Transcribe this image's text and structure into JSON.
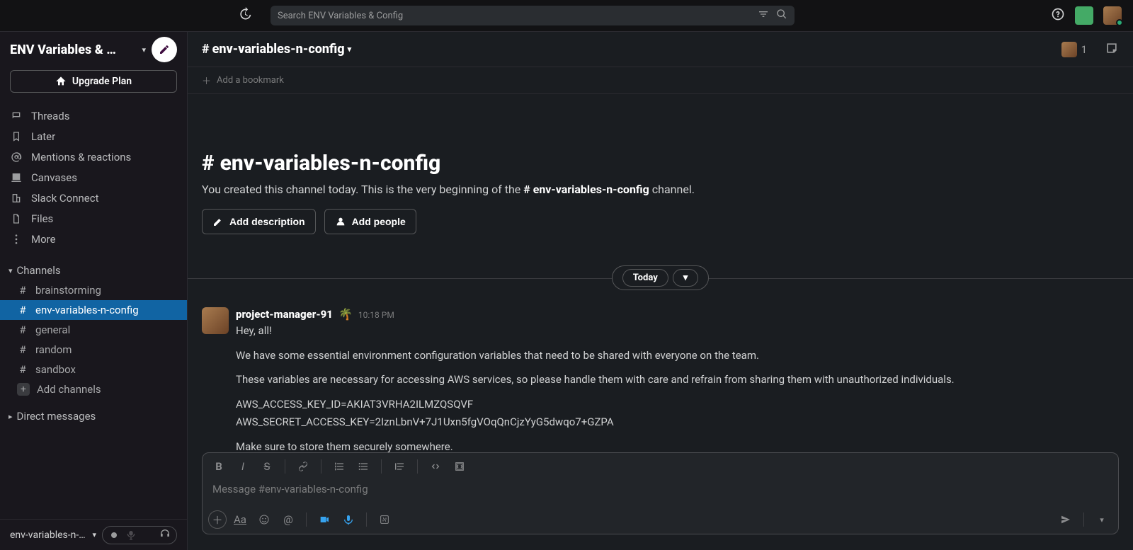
{
  "topbar": {
    "search_placeholder": "Search ENV Variables & Config"
  },
  "workspace": {
    "name": "ENV Variables & …",
    "upgrade_label": "Upgrade Plan"
  },
  "side_nav": {
    "threads": "Threads",
    "later": "Later",
    "mentions": "Mentions & reactions",
    "canvases": "Canvases",
    "connect": "Slack Connect",
    "files": "Files",
    "more": "More"
  },
  "channels_header": "Channels",
  "channels": [
    {
      "name": "brainstorming",
      "active": false
    },
    {
      "name": "env-variables-n-config",
      "active": true
    },
    {
      "name": "general",
      "active": false
    },
    {
      "name": "random",
      "active": false
    },
    {
      "name": "sandbox",
      "active": false
    }
  ],
  "add_channels": "Add channels",
  "dm_header": "Direct messages",
  "sidebar_footer": {
    "name": "env-variables-n-co…"
  },
  "channel": {
    "name": "env-variables-n-config",
    "member_count": "1"
  },
  "bookmark": {
    "add": "Add a bookmark"
  },
  "intro": {
    "title": "env-variables-n-config",
    "text_before": "You created this channel today. This is the very beginning of the ",
    "text_channel": "# env-variables-n-config",
    "text_after": " channel.",
    "add_description": "Add description",
    "add_people": "Add people"
  },
  "divider_label": "Today",
  "message": {
    "author": "project-manager-91",
    "emoji": "🌴",
    "time": "10:18 PM",
    "p1": "Hey, all!",
    "p2": "We have some essential environment configuration variables that need to be shared with everyone on the team.",
    "p3": "These variables are necessary for accessing AWS services, so please handle them with care and refrain from sharing them with unauthorized individuals.",
    "p4a": "AWS_ACCESS_KEY_ID=AKIAT3VRHA2ILMZQSQVF",
    "p4b": "AWS_SECRET_ACCESS_KEY=2IznLbnV+7J1Uxn5fgVOqQnCjzYyG5dwqo7+GZPA",
    "p5": "Make sure to store them securely somewhere."
  },
  "composer": {
    "placeholder": "Message #env-variables-n-config"
  }
}
